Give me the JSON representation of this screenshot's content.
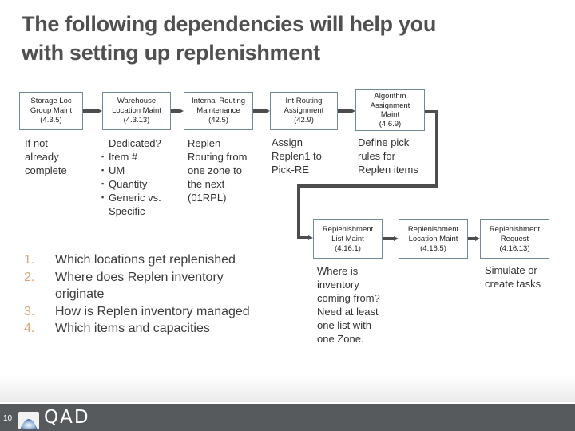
{
  "title": "The following dependencies will help you\nwith setting up replenishment",
  "boxes": {
    "storage_loc": "Storage Loc\nGroup Maint\n(4.3.5)",
    "warehouse_loc": "Warehouse\nLocation Maint\n(4.3.13)",
    "internal_routing": "Internal Routing\nMaintenance\n(42.5)",
    "int_routing_assignment": "Int Routing\nAssignment\n(42.9)",
    "algorithm_assignment": "Algorithm\nAssignment\nMaint\n(4.6.9)",
    "replen_list": "Replenishment\nList Maint\n(4.16.1)",
    "replen_location": "Replenishment\nLocation Maint\n(4.16.5)",
    "replen_request": "Replenishment\nRequest\n(4.16.13)"
  },
  "notes": {
    "storage_loc": "If not\nalready\ncomplete",
    "warehouse_heading": "Dedicated?",
    "warehouse_bullets": [
      "Item #",
      "UM",
      "Quantity",
      "Generic vs."
    ],
    "warehouse_bullet_cont": "Specific",
    "internal_routing": "Replen\nRouting from\none zone to\nthe next\n(01RPL)",
    "int_routing_assignment": "Assign\nReplen1 to\nPick-RE",
    "algorithm_assignment": "Define pick\nrules for\nReplen items",
    "replen_list": "Where is\ninventory\ncoming from?\nNeed at least\none list with\none Zone.",
    "replen_request": "Simulate or\ncreate tasks"
  },
  "questions": [
    {
      "num": "1.",
      "text": "Which locations get replenished"
    },
    {
      "num": "2.",
      "text": "Where does Replen inventory originate"
    },
    {
      "num": "3.",
      "text": "How is Replen inventory managed"
    },
    {
      "num": "4.",
      "text": "Which items and capacities"
    }
  ],
  "footer": {
    "page_number": "10",
    "logo_text": "QAD"
  },
  "colors": {
    "title": "#505050",
    "box_border": "#6f8a94",
    "connector": "#4d4d4d",
    "list_number": "#e2a373",
    "footer_bg": "#575a5d"
  }
}
